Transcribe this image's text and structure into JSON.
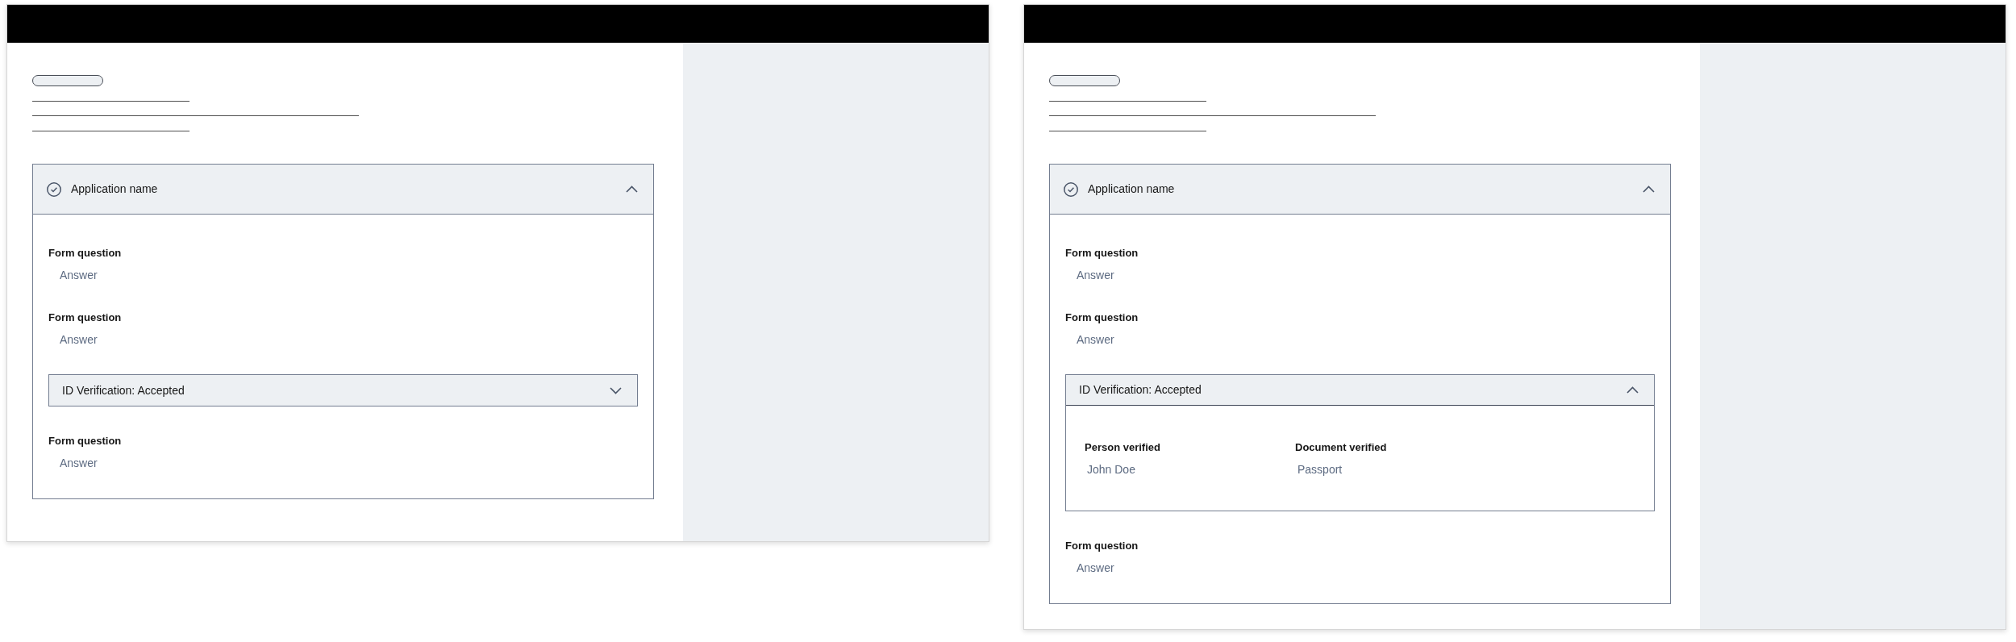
{
  "screens": [
    {
      "accordion": {
        "title": "Application name",
        "expanded": true,
        "items": [
          {
            "kind": "question",
            "label": "Form question",
            "answer": "Answer"
          },
          {
            "kind": "question",
            "label": "Form question",
            "answer": "Answer"
          },
          {
            "kind": "verification",
            "title": "ID Verification: Accepted",
            "expanded": false
          },
          {
            "kind": "question",
            "label": "Form question",
            "answer": "Answer"
          }
        ]
      }
    },
    {
      "accordion": {
        "title": "Application name",
        "expanded": true,
        "items": [
          {
            "kind": "question",
            "label": "Form question",
            "answer": "Answer"
          },
          {
            "kind": "question",
            "label": "Form question",
            "answer": "Answer"
          },
          {
            "kind": "verification",
            "title": "ID Verification: Accepted",
            "expanded": true,
            "fields": [
              {
                "label": "Person verified",
                "value": "John Doe"
              },
              {
                "label": "Document verified",
                "value": "Passport"
              }
            ]
          },
          {
            "kind": "question",
            "label": "Form question",
            "answer": "Answer"
          }
        ]
      }
    }
  ]
}
